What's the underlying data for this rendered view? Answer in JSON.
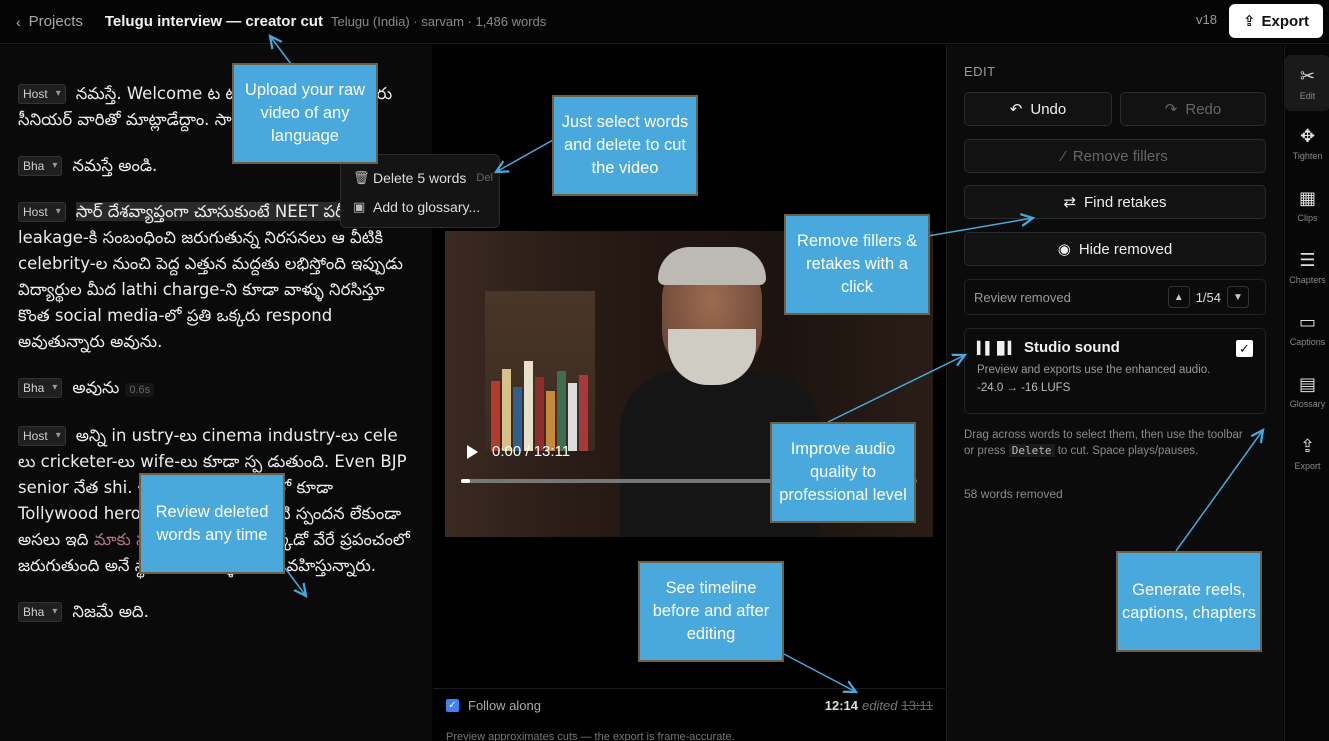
{
  "topbar": {
    "back_label": "Projects",
    "title": "Telugu interview — creator cut",
    "meta": "Telugu (India) · sarvam · 1,486 words",
    "version": "v18",
    "export_label": "Export"
  },
  "transcript": {
    "paragraphs": [
      {
        "speaker": "Host",
        "text": "నమస్తే. Welcome ట                      టు మనతో పాటు ఉన్నారు సీనియర్              వారితో మాట్లాడేద్దాం. సార్ నమస్తే"
      },
      {
        "speaker": "Bha",
        "text": "నమస్తే అండి."
      },
      {
        "speaker": "Host",
        "selected": "సార్ దేశవ్యాప్తంగా చూసుకుంటే NEET పరీక్షా",
        "text": "పత్రా leakage-కి సంబంధించి జరుగుతున్న నిరసనలు ఆ వీటికి celebrity-ల నుంచి పెద్ద ఎత్తున మద్దతు లభిస్తోంది ఇప్పుడు విద్యార్థుల మీద lathi charge-ని కూడా వాళ్ళు నిరసిస్తూ కొంత social media-లో ప్రతి ఒక్కరు respond అవుతున్నారు అవును."
      },
      {
        "speaker": "Bha",
        "text": "అవును",
        "pause": "0.6s"
      },
      {
        "speaker": "Host",
        "text": "అన్ని in                           ustry-లు cinema industry-లు cele                   లు cricketer-లు wife-లు కూడా స్ప                    డుతుంది. Even BJP senior నేత                     shi. ఇలాంటి ఒక సందర్భంలో కూడా Tollywood hero-లు అయితే ఆ ఎలాంటి స్పందన లేకుండా అసలు ఇది",
        "removed": "మాకు సంబంధం",
        "text2": "లేదు ఇది ఎక్కడో వేరే ప్రపంచంలో జరుగుతుంది అనే స్థాయిలో వాళ్ళు మౌనం వహిస్తున్నారు."
      },
      {
        "speaker": "Bha",
        "text": "నిజమే అది."
      }
    ]
  },
  "context_menu": {
    "items": [
      {
        "label": "Delete 5 words",
        "shortcut": "Del",
        "icon": "trash-icon"
      },
      {
        "label": "Add to glossary...",
        "icon": "bookmark-icon"
      }
    ]
  },
  "player": {
    "time": "0:00 / 13:11",
    "progress": 0.02,
    "follow_label": "Follow along",
    "follow_checked": true,
    "timeline_edited": "12:14",
    "timeline_edited_label": "edited",
    "timeline_original": "13:11",
    "footnote": "Preview approximates cuts — the export is frame-accurate."
  },
  "edit_panel": {
    "label": "EDIT",
    "undo": "Undo",
    "redo": "Redo",
    "remove_fillers": "Remove fillers",
    "find_retakes": "Find retakes",
    "hide_removed": "Hide removed",
    "review_label": "Review removed",
    "review_position": "1/54",
    "studio_title": "Studio sound",
    "studio_enabled": true,
    "studio_desc": "Preview and exports use the enhanced audio.",
    "studio_lufs": "-24.0 → -16 LUFS",
    "hint_before": "Drag across words to select them, then use the toolbar or press ",
    "hint_key": "Delete",
    "hint_after": " to cut. Space plays/pauses.",
    "removed_count": "58 words removed"
  },
  "rail": {
    "items": [
      {
        "label": "Edit",
        "icon": "scissors-icon",
        "glyph": "✂"
      },
      {
        "label": "Tighten",
        "icon": "tighten-icon",
        "glyph": "✥"
      },
      {
        "label": "Clips",
        "icon": "film-icon",
        "glyph": "▦"
      },
      {
        "label": "Chapters",
        "icon": "chapters-icon",
        "glyph": "☰"
      },
      {
        "label": "Captions",
        "icon": "captions-icon",
        "glyph": "▭"
      },
      {
        "label": "Glossary",
        "icon": "glossary-icon",
        "glyph": "▤"
      },
      {
        "label": "Export",
        "icon": "share-icon",
        "glyph": "⇪"
      }
    ]
  },
  "callouts": {
    "upload": "Upload your raw video of any language",
    "select": "Just select words and delete to cut the video",
    "fillers": "Remove fillers & retakes with a click",
    "audio": "Improve audio quality to professional level",
    "review": "Review deleted words any time",
    "timeline": "See timeline before and after editing",
    "generate": "Generate reels, captions, chapters"
  },
  "colors": {
    "callout_bg": "#49a8dc",
    "arrow": "#49a8dc",
    "accent_blue": "#3d82f6",
    "removed_text": "#b0737f"
  }
}
